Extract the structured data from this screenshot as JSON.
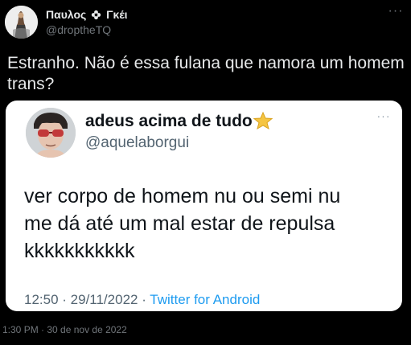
{
  "tweet": {
    "author": {
      "name": "Παυλος",
      "name_suffix": "Γκέι",
      "handle": "@droptheTQ"
    },
    "more_label": "···",
    "text": "Estranho. Não é essa fulana que namora um homem trans?",
    "timestamp": "1:30 PM · 30 de nov de 2022"
  },
  "quoted": {
    "author": {
      "name": "adeus acima de tudo",
      "handle": "@aquelaborgui"
    },
    "more_label": "···",
    "lines": [
      "ver corpo de homem nu ou semi nu",
      "me dá até um mal estar de repulsa",
      "kkkkkkkkkkk"
    ],
    "time": "12:50",
    "date": "29/11/2022",
    "separator": " · ",
    "source": "Twitter for Android"
  },
  "icons": {
    "name_flower": "flower-icon",
    "name_star": "star-icon"
  },
  "colors": {
    "background": "#000000",
    "text_primary": "#e7e9ea",
    "text_secondary": "#71767b",
    "card": "#ffffff",
    "link": "#1d9bf0",
    "star": "#f5c542"
  }
}
